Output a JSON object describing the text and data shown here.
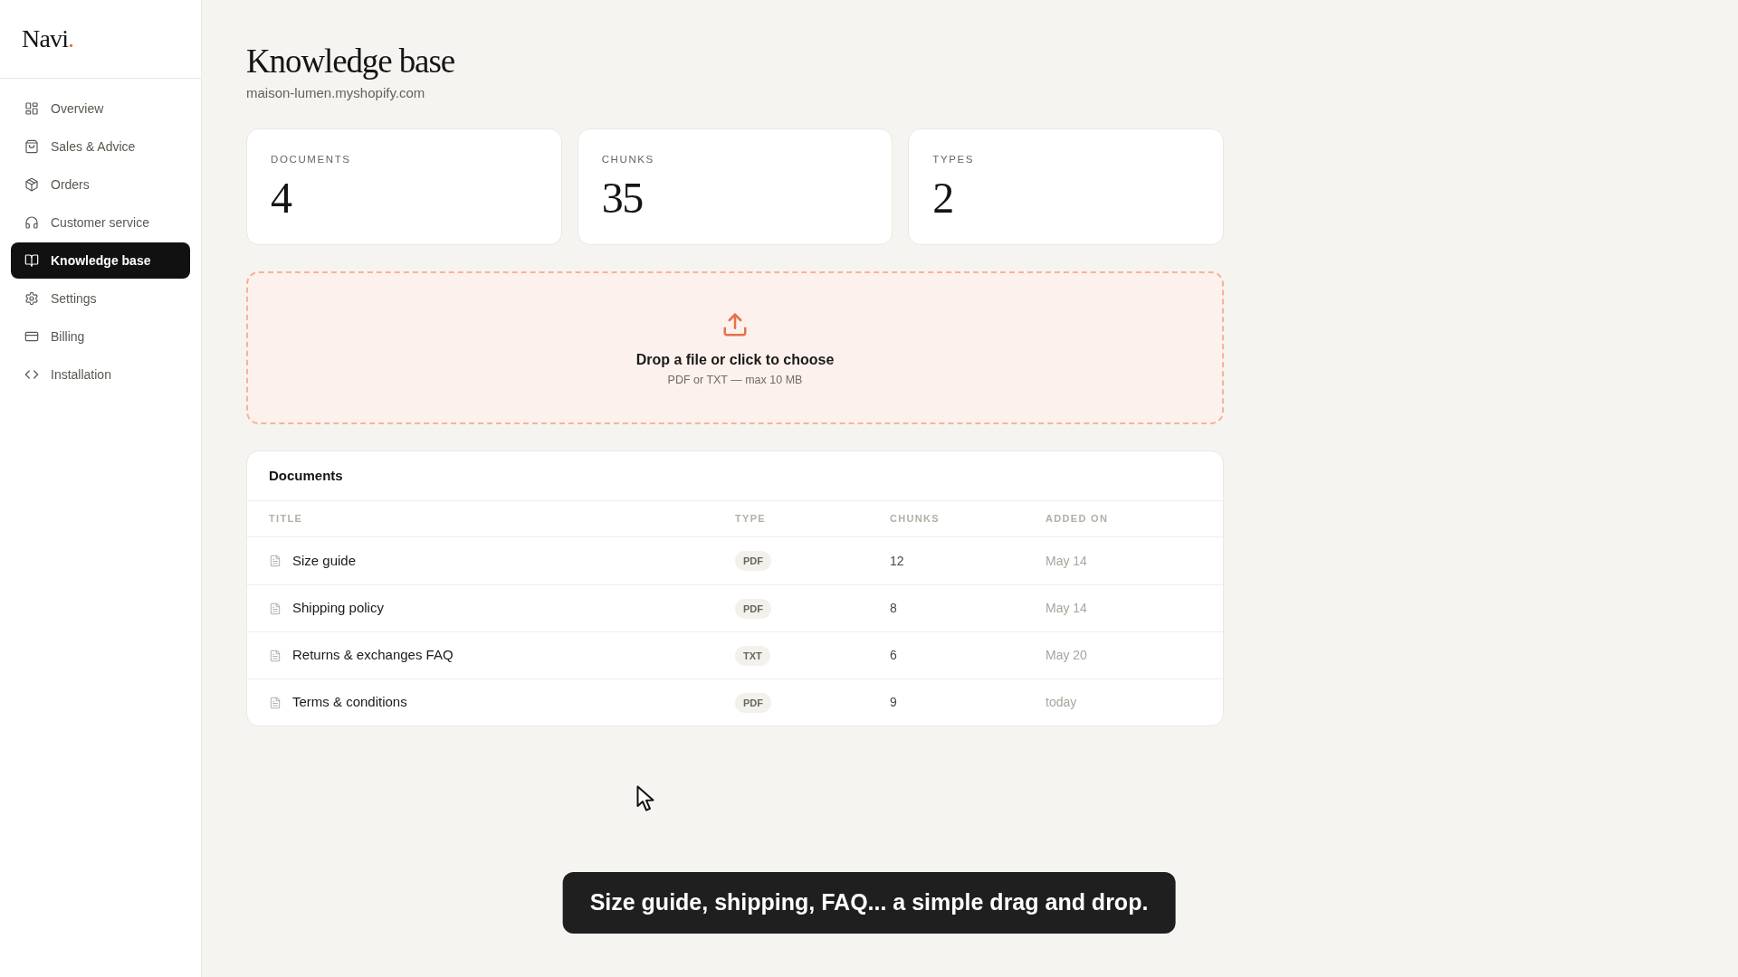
{
  "sidebar": {
    "logo": {
      "name": "Navi",
      "dot": "."
    },
    "items": [
      {
        "label": "Overview",
        "selected": false
      },
      {
        "label": "Sales & Advice",
        "selected": false
      },
      {
        "label": "Orders",
        "selected": false
      },
      {
        "label": "Customer service",
        "selected": false
      },
      {
        "label": "Knowledge base",
        "selected": true
      },
      {
        "label": "Settings",
        "selected": false
      },
      {
        "label": "Billing",
        "selected": false
      },
      {
        "label": "Installation",
        "selected": false
      }
    ]
  },
  "header": {
    "title": "Knowledge base",
    "subtitle": "maison-lumen.myshopify.com"
  },
  "stats": [
    {
      "label": "DOCUMENTS",
      "value": "4"
    },
    {
      "label": "CHUNKS",
      "value": "35"
    },
    {
      "label": "TYPES",
      "value": "2"
    }
  ],
  "upload": {
    "title": "Drop a file or click to choose",
    "hint": "PDF or TXT — max 10 MB"
  },
  "documents": {
    "title": "Documents",
    "columns": [
      "TITLE",
      "TYPE",
      "CHUNKS",
      "ADDED ON"
    ],
    "rows": [
      {
        "title": "Size guide",
        "type": "PDF",
        "chunks": "12",
        "added_on": "May 14"
      },
      {
        "title": "Shipping policy",
        "type": "PDF",
        "chunks": "8",
        "added_on": "May 14"
      },
      {
        "title": "Returns & exchanges FAQ",
        "type": "TXT",
        "chunks": "6",
        "added_on": "May 20"
      },
      {
        "title": "Terms & conditions",
        "type": "PDF",
        "chunks": "9",
        "added_on": "today"
      }
    ]
  },
  "caption": "Size guide, shipping, FAQ... a simple drag and drop."
}
